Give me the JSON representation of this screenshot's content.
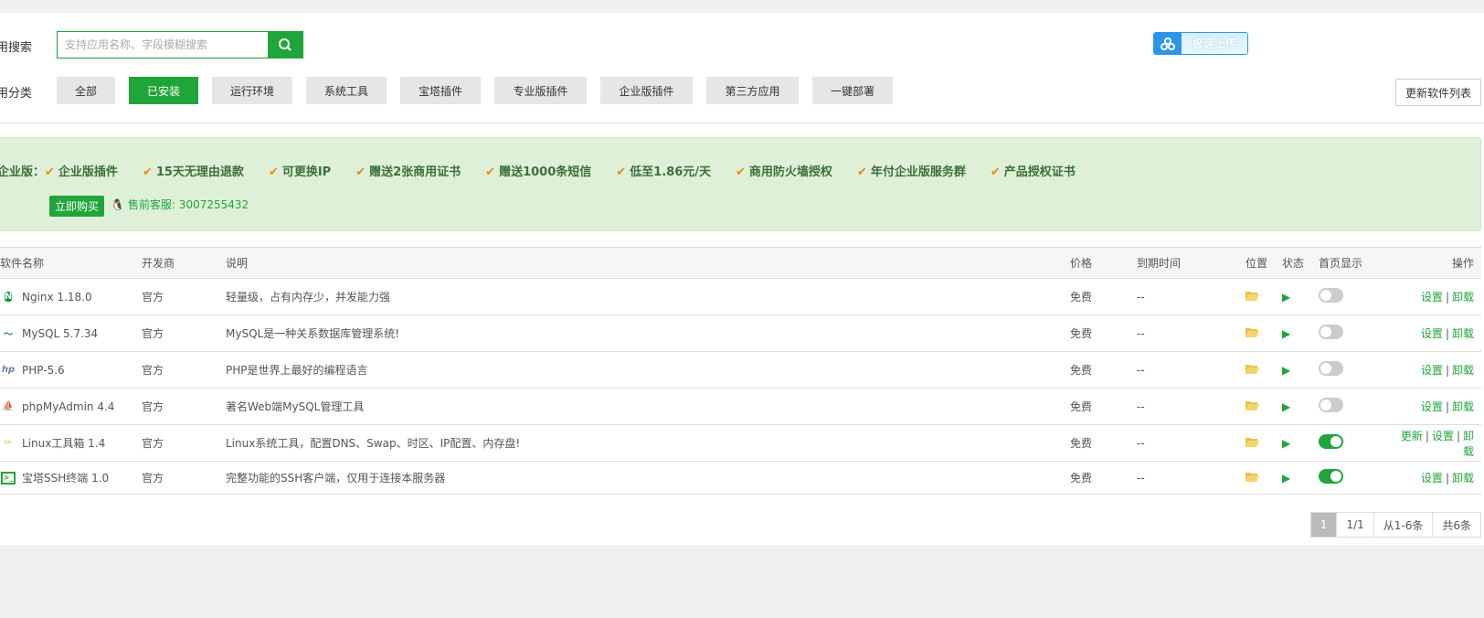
{
  "search": {
    "label": "用搜索",
    "placeholder": "支持应用名称、字段模糊搜索"
  },
  "upload": {
    "label": "极速上传"
  },
  "categories": {
    "label": "用分类",
    "items": [
      {
        "label": "全部",
        "active": false
      },
      {
        "label": "已安装",
        "active": true
      },
      {
        "label": "运行环境",
        "active": false
      },
      {
        "label": "系统工具",
        "active": false
      },
      {
        "label": "宝塔插件",
        "active": false
      },
      {
        "label": "专业版插件",
        "active": false
      },
      {
        "label": "企业版插件",
        "active": false
      },
      {
        "label": "第三方应用",
        "active": false
      },
      {
        "label": "一键部署",
        "active": false
      }
    ]
  },
  "refresh_label": "更新软件列表",
  "banner": {
    "title": "企业版：",
    "features": [
      "企业版插件",
      "15天无理由退款",
      "可更换IP",
      "赠送2张商用证书",
      "赠送1000条短信",
      "低至1.86元/天",
      "商用防火墙授权",
      "年付企业版服务群",
      "产品授权证书"
    ],
    "buy_label": "立即购买",
    "service": "售前客服: 3007255432"
  },
  "table": {
    "headers": [
      "软件名称",
      "开发商",
      "说明",
      "价格",
      "到期时间",
      "位置",
      "状态",
      "首页显示",
      "操作"
    ],
    "rows": [
      {
        "name": "Nginx 1.18.0",
        "vendor": "官方",
        "desc": "轻量级，占有内存少，并发能力强",
        "price": "免费",
        "expire": "--",
        "home": false,
        "ops": [
          "设置",
          "卸载"
        ],
        "icon": "nginx-icon"
      },
      {
        "name": "MySQL 5.7.34",
        "vendor": "官方",
        "desc": "MySQL是一种关系数据库管理系统!",
        "price": "免费",
        "expire": "--",
        "home": false,
        "ops": [
          "设置",
          "卸载"
        ],
        "icon": "mysql-icon"
      },
      {
        "name": "PHP-5.6",
        "vendor": "官方",
        "desc": "PHP是世界上最好的编程语言",
        "price": "免费",
        "expire": "--",
        "home": false,
        "ops": [
          "设置",
          "卸载"
        ],
        "icon": "php-icon"
      },
      {
        "name": "phpMyAdmin 4.4",
        "vendor": "官方",
        "desc": "著名Web端MySQL管理工具",
        "price": "免费",
        "expire": "--",
        "home": false,
        "ops": [
          "设置",
          "卸载"
        ],
        "icon": "phpmyadmin-icon"
      },
      {
        "name": "Linux工具箱 1.4",
        "vendor": "官方",
        "desc": "Linux系统工具，配置DNS、Swap、时区、IP配置、内存盘!",
        "price": "免费",
        "expire": "--",
        "home": true,
        "ops": [
          "更新",
          "设置",
          "卸载"
        ],
        "icon": "linux-tools-icon"
      },
      {
        "name": "宝塔SSH终端 1.0",
        "vendor": "官方",
        "desc": "完整功能的SSH客户端，仅用于连接本服务器",
        "price": "免费",
        "expire": "--",
        "home": true,
        "ops": [
          "设置",
          "卸载"
        ],
        "icon": "ssh-terminal-icon"
      }
    ]
  },
  "pager": {
    "current": "1",
    "pages": "1/1",
    "range": "从1-6条",
    "total": "共6条"
  },
  "colors": {
    "accent": "#20a53a",
    "banner_bg": "#dff0d8",
    "check": "#f0880a",
    "folder": "#f5d56b"
  }
}
